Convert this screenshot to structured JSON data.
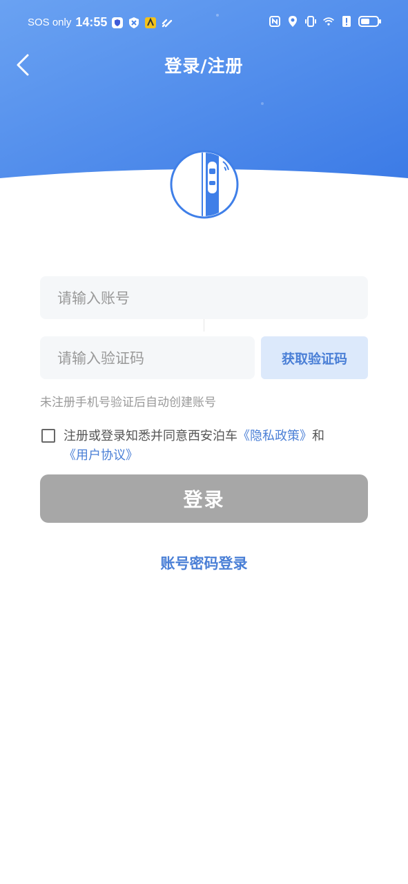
{
  "status_bar": {
    "carrier": "SOS only",
    "time": "14:55"
  },
  "nav": {
    "title": "登录/注册"
  },
  "form": {
    "account_placeholder": "请输入账号",
    "code_placeholder": "请输入验证码",
    "get_code_label": "获取验证码",
    "hint": "未注册手机号验证后自动创建账号"
  },
  "agreement": {
    "prefix": "注册或登录知悉并同意西安泊车",
    "privacy_link": "《隐私政策》",
    "conjunction": "和",
    "user_link": "《用户协议》",
    "checked": false
  },
  "login_label": "登录",
  "password_login_label": "账号密码登录",
  "colors": {
    "header_gradient_start": "#5f9af0",
    "header_gradient_end": "#3f7fe8",
    "accent": "#4a7fd6",
    "login_button_disabled": "#a7a7a7"
  }
}
